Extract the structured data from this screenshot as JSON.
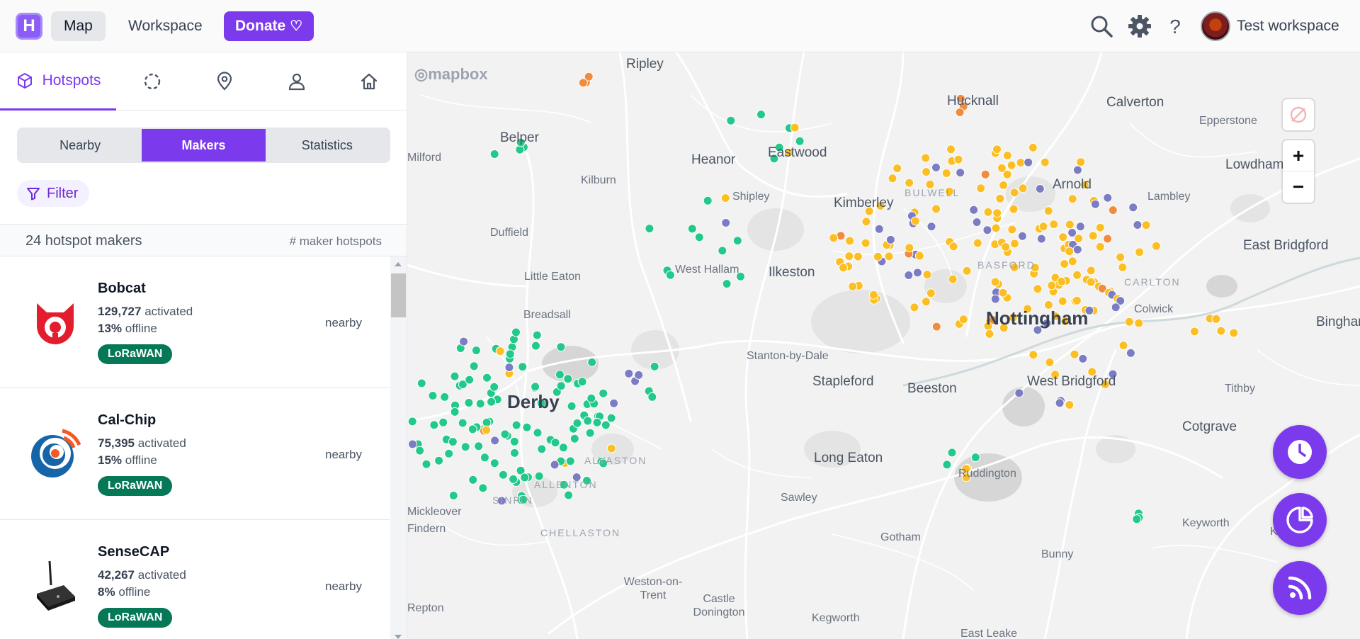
{
  "topbar": {
    "logo_letter": "H",
    "nav": {
      "map": "Map",
      "workspace": "Workspace",
      "donate": "Donate"
    },
    "workspace_name": "Test workspace"
  },
  "sidebar": {
    "active_tab": "Hotspots",
    "segments": [
      "Nearby",
      "Makers",
      "Statistics"
    ],
    "active_segment": "Makers",
    "filter_label": "Filter",
    "list_header": {
      "count_label": "24 hotspot makers",
      "column_label": "# maker hotspots"
    },
    "makers": [
      {
        "name": "Bobcat",
        "activated": "129,727",
        "activated_label": "activated",
        "offline": "13%",
        "offline_label": "offline",
        "badge": "LoRaWAN",
        "nearby": "nearby"
      },
      {
        "name": "Cal-Chip",
        "activated": "75,395",
        "activated_label": "activated",
        "offline": "15%",
        "offline_label": "offline",
        "badge": "LoRaWAN",
        "nearby": "nearby"
      },
      {
        "name": "SenseCAP",
        "activated": "42,267",
        "activated_label": "activated",
        "offline": "8%",
        "offline_label": "offline",
        "badge": "LoRaWAN",
        "nearby": "nearby"
      }
    ]
  },
  "map": {
    "attribution": "mapbox",
    "places": [
      "Ripley",
      "Hucknall",
      "Calverton",
      "Epperstone",
      "Belper",
      "Heanor",
      "Eastwood",
      "Kimberley",
      "BULWELL",
      "Arnold",
      "Lowdham",
      "Lambley",
      "Duffield",
      "Shipley",
      "East Bridgford",
      "Little Eaton",
      "West Hallam",
      "Ilkeston",
      "BASFORD",
      "CARLTON",
      "Breadsall",
      "Nottingham",
      "Colwick",
      "Bingham",
      "Stanton-by-Dale",
      "Stapleford",
      "Beeston",
      "West Bridgford",
      "Tithby",
      "Derby",
      "Cotgrave",
      "Long Eaton",
      "Ruddington",
      "ALVASTON",
      "ALLENTON",
      "SINFIN",
      "Sawley",
      "CHELLASTON",
      "Gotham",
      "Keyworth",
      "Kinoulton",
      "Bunny",
      "Weston-on-Trent",
      "Castle Donington",
      "Kegworth",
      "East Leake",
      "Mickleover",
      "Findern",
      "Repton",
      "Kilburn",
      "Milford"
    ],
    "colors": {
      "green": "#22c98a",
      "yellow": "#fbbf24",
      "purple": "#7c7cc4",
      "orange": "#f28c3c"
    },
    "zoom_in": "+",
    "zoom_out": "−"
  }
}
